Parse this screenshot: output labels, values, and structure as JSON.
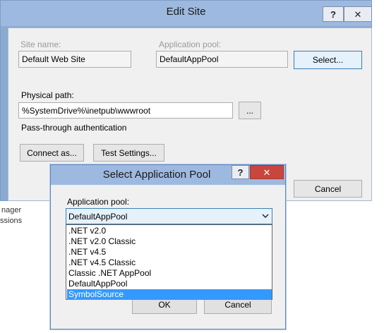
{
  "background": {
    "text_1": "nager",
    "text_2": "ssions"
  },
  "edit_site": {
    "title": "Edit Site",
    "help_button": "?",
    "close_button": "✕",
    "site_name_label": "Site name:",
    "site_name_value": "Default Web Site",
    "app_pool_label": "Application pool:",
    "app_pool_value": "DefaultAppPool",
    "select_button": "Select...",
    "physical_path_label": "Physical path:",
    "physical_path_value": "%SystemDrive%\\inetpub\\wwwroot",
    "browse_button": "...",
    "passthrough_label": "Pass-through authentication",
    "connect_as_button": "Connect as...",
    "test_settings_button": "Test Settings...",
    "cancel_button": "Cancel"
  },
  "select_pool": {
    "title": "Select Application Pool",
    "help_button": "?",
    "close_button": "✕",
    "pool_label": "Application pool:",
    "selected_value": "DefaultAppPool",
    "options": [
      ".NET v2.0",
      ".NET v2.0 Classic",
      ".NET v4.5",
      ".NET v4.5 Classic",
      "Classic .NET AppPool",
      "DefaultAppPool",
      "SymbolSource"
    ],
    "highlighted_option": "SymbolSource",
    "ok_button": "OK",
    "cancel_button": "Cancel"
  },
  "colors": {
    "title_bar": "#9db9df",
    "selection": "#3399ff",
    "close_red": "#c9463d"
  }
}
